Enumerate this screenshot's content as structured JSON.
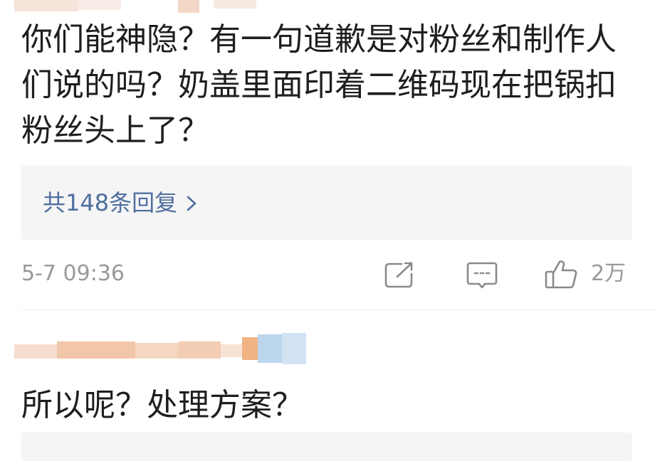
{
  "comments": [
    {
      "lines": [
        "你们能神隐？有一句道歉是对粉丝和制作人",
        "们说的吗？奶盖里面印着二维码现在把锅扣",
        "粉丝头上了？"
      ],
      "replies_label": "共148条回复",
      "time": "5-7 09:36",
      "likes": "2万",
      "icons": [
        "repost-icon",
        "comment-icon",
        "like-icon",
        "chevron-right-icon"
      ]
    },
    {
      "lines": [
        "所以呢？处理方案？"
      ]
    }
  ],
  "colors": {
    "text": "#1e1e1e",
    "link": "#4f6f9f",
    "meta": "#999999",
    "reply_box_bg": "#f5f5f5",
    "divider": "#ececec"
  }
}
